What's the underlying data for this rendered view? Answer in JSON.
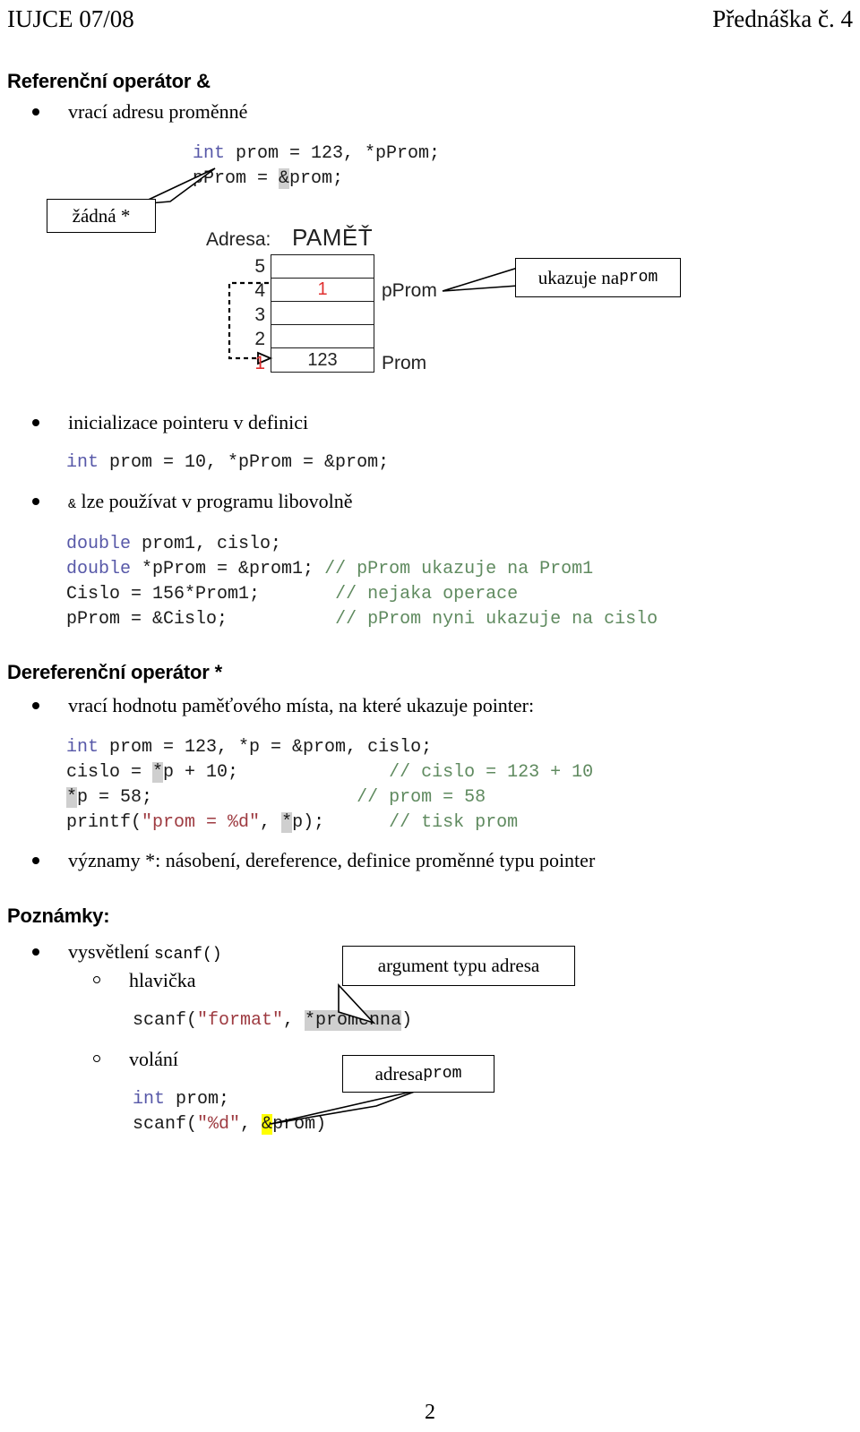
{
  "header": {
    "left": "IUJCE 07/08",
    "right": "Přednáška č. 4"
  },
  "sections": {
    "reference": {
      "heading": "Referenční operátor &",
      "bullet_1": "vrací adresu proměnné",
      "code_1_line_1_kw": "int",
      "code_1_line_1_rest": " prom = 123, *pProm;",
      "code_1_line_2_a": "pProm = ",
      "code_1_line_2_amp": "&",
      "code_1_line_2_b": "prom;",
      "callout_zadna": "žádná *",
      "callout_ukazuje_a": "ukazuje na ",
      "callout_ukazuje_b": "prom",
      "bullet_2": "inicializace pointeru v definici",
      "code_2_kw": "int",
      "code_2_rest": " prom = 10, *pProm = &prom;",
      "bullet_3_amp": "&",
      "bullet_3_text": " lze používat v programu libovolně",
      "code_3": [
        {
          "kw": "double",
          "rest": " prom1, cislo;",
          "cmt": ""
        },
        {
          "kw": "double",
          "rest": " *pProm = &prom1; ",
          "cmt": "// pProm ukazuje na Prom1"
        },
        {
          "kw": "",
          "rest": "Cislo = 156*Prom1;       ",
          "cmt": "// nejaka operace"
        },
        {
          "kw": "",
          "rest": "pProm = &Cislo;          ",
          "cmt": "// pProm nyni ukazuje na cislo"
        }
      ]
    },
    "dereference": {
      "heading": "Dereferenční operátor *",
      "bullet_1": "vrací hodnotu paměťového místa, na které ukazuje pointer:",
      "code_line_1_kw": "int",
      "code_line_1_rest": " prom = 123, *p = &prom, cislo;",
      "code_line_2_a": "cislo = ",
      "code_line_2_star": "*",
      "code_line_2_b": "p + 10;",
      "code_line_2_pad": "              ",
      "code_line_2_cmt": "// cislo = 123 + 10",
      "code_line_3_star": "*",
      "code_line_3_b": "p = 58;",
      "code_line_3_pad": "                   ",
      "code_line_3_cmt": "// prom = 58",
      "code_line_4_a": "printf(",
      "code_line_4_str": "\"prom = %d\"",
      "code_line_4_b": ", ",
      "code_line_4_star": "*",
      "code_line_4_c": "p);",
      "code_line_4_pad": "      ",
      "code_line_4_cmt": "// tisk prom",
      "bullet_2": "významy *: násobení, dereference, definice proměnné typu pointer"
    },
    "poznamky": {
      "heading": "Poznámky:",
      "bullet_1_a": "vysvětlení ",
      "bullet_1_b": "scanf()",
      "sub_1": "hlavička",
      "scanf_header_a": "scanf(",
      "scanf_header_str": "\"format\"",
      "scanf_header_b": ", ",
      "scanf_header_hl": "*promenna",
      "scanf_header_c": ")",
      "callout_argument": "argument typu adresa",
      "sub_2": "volání",
      "call_line_1_kw": "int",
      "call_line_1_rest": " prom;",
      "call_line_2_a": "scanf(",
      "call_line_2_str": "\"%d\"",
      "call_line_2_b": ", ",
      "call_line_2_hl": "&",
      "call_line_2_c": "prom)",
      "callout_adresa_a": "adresa ",
      "callout_adresa_b": "prom"
    }
  },
  "memory_diagram": {
    "label_adresa": "Adresa:",
    "title": "PAMĚŤ",
    "rows": [
      {
        "addr": "5",
        "value": "",
        "name": "",
        "addr_red": false,
        "value_red": false
      },
      {
        "addr": "4",
        "value": "1",
        "name": "pProm",
        "addr_red": false,
        "value_red": true
      },
      {
        "addr": "3",
        "value": "",
        "name": "",
        "addr_red": false,
        "value_red": false
      },
      {
        "addr": "2",
        "value": "",
        "name": "",
        "addr_red": false,
        "value_red": false
      },
      {
        "addr": "1",
        "value": "123",
        "name": "Prom",
        "addr_red": true,
        "value_red": false
      }
    ]
  },
  "page_number": "2",
  "colors": {
    "keyword": "#5758a8",
    "comment": "#5f8a5f",
    "string": "#9e3b41",
    "highlight_gray": "#cfcfcf",
    "highlight_yellow": "#ffff00",
    "red_accent": "#e03030"
  }
}
